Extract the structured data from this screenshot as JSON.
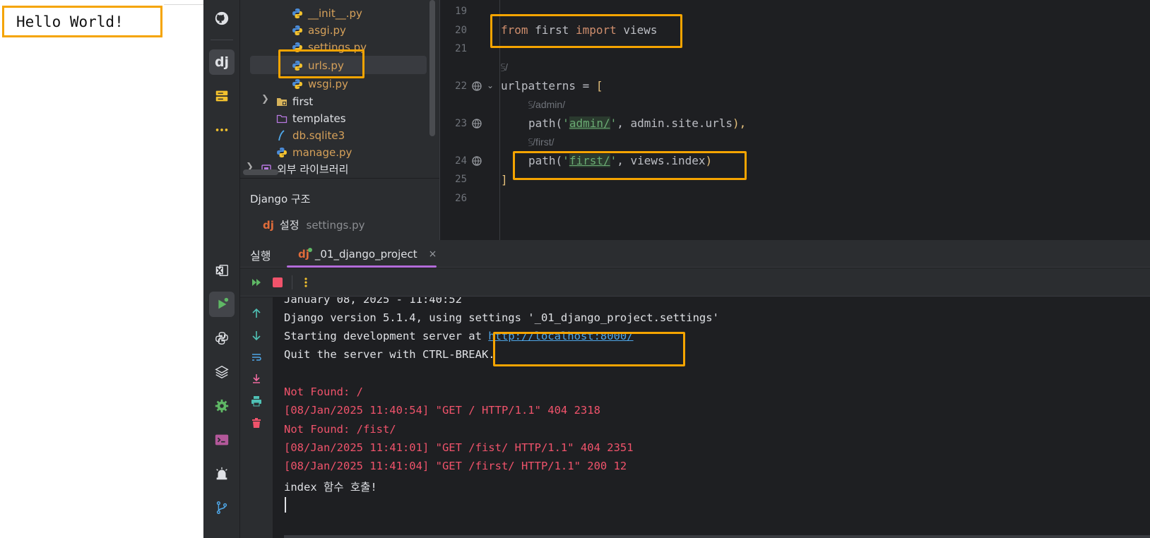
{
  "browser": {
    "page_text": "Hello World!"
  },
  "activity_bar": {
    "icons": [
      "github-icon",
      "django-icon",
      "database-icon",
      "more-icon",
      "excel-icon",
      "run-icon",
      "python-console-icon",
      "layers-icon",
      "services-icon",
      "terminal-icon",
      "problems-icon",
      "git-icon"
    ]
  },
  "project_tree": {
    "items": [
      {
        "label": "__init__.py"
      },
      {
        "label": "asgi.py"
      },
      {
        "label": "settings.py"
      },
      {
        "label": "urls.py"
      },
      {
        "label": "wsgi.py"
      },
      {
        "label": "first"
      },
      {
        "label": "templates"
      },
      {
        "label": "db.sqlite3"
      },
      {
        "label": "manage.py"
      },
      {
        "label": "외부 라이브러리"
      }
    ]
  },
  "django_structure": {
    "title": "Django 구조",
    "item_label": "설정",
    "item_file": "settings.py",
    "item_icon": "dj"
  },
  "editor": {
    "line_numbers": [
      "19",
      "20",
      "21",
      "22",
      "23",
      "24",
      "25",
      "26"
    ],
    "line20": {
      "kw1": "from",
      "mod": " first ",
      "kw2": "import",
      "rest": " views"
    },
    "hint_root": "/",
    "line22": {
      "name": "urlpatterns = ",
      "bracket": "["
    },
    "hint_admin": "/admin/",
    "line23": {
      "fn": "path(",
      "q1": "'",
      "route": "admin/",
      "q2": "'",
      "rest": ", admin.site.urls",
      "close": "),"
    },
    "hint_first": "/first/",
    "line24": {
      "fn": "path(",
      "q1": "'",
      "route": "first/",
      "q2": "'",
      "rest": ", views.index",
      "close": ")"
    },
    "line25": "]"
  },
  "run_window": {
    "title": "실행",
    "tab_icon": "dj",
    "tab_label": "_01_django_project",
    "tab_close": "×"
  },
  "console": {
    "line_partial": "January 08, 2025 - 11:40:52",
    "line_version": "Django version 5.1.4, using settings '_01_django_project.settings'",
    "line_start_prefix": "Starting development server at ",
    "line_start_url": "http://localhost:8000/",
    "line_quit": "Quit the server with CTRL-BREAK.",
    "line_nf1": "Not Found: /",
    "line_log1": "[08/Jan/2025 11:40:54] \"GET / HTTP/1.1\" 404 2318",
    "line_nf2": "Not Found: /fist/",
    "line_log2": "[08/Jan/2025 11:41:01] \"GET /fist/ HTTP/1.1\" 404 2351",
    "line_log3": "[08/Jan/2025 11:41:04] \"GET /first/ HTTP/1.1\" 200 12",
    "line_index": "index 함수 호출!"
  },
  "colors": {
    "highlight": "#f5a400",
    "keyword": "#cf8e6d",
    "string": "#6aab73",
    "error": "#f0536b",
    "link": "#4fa7e8",
    "tab_underline": "#b36cd9"
  }
}
